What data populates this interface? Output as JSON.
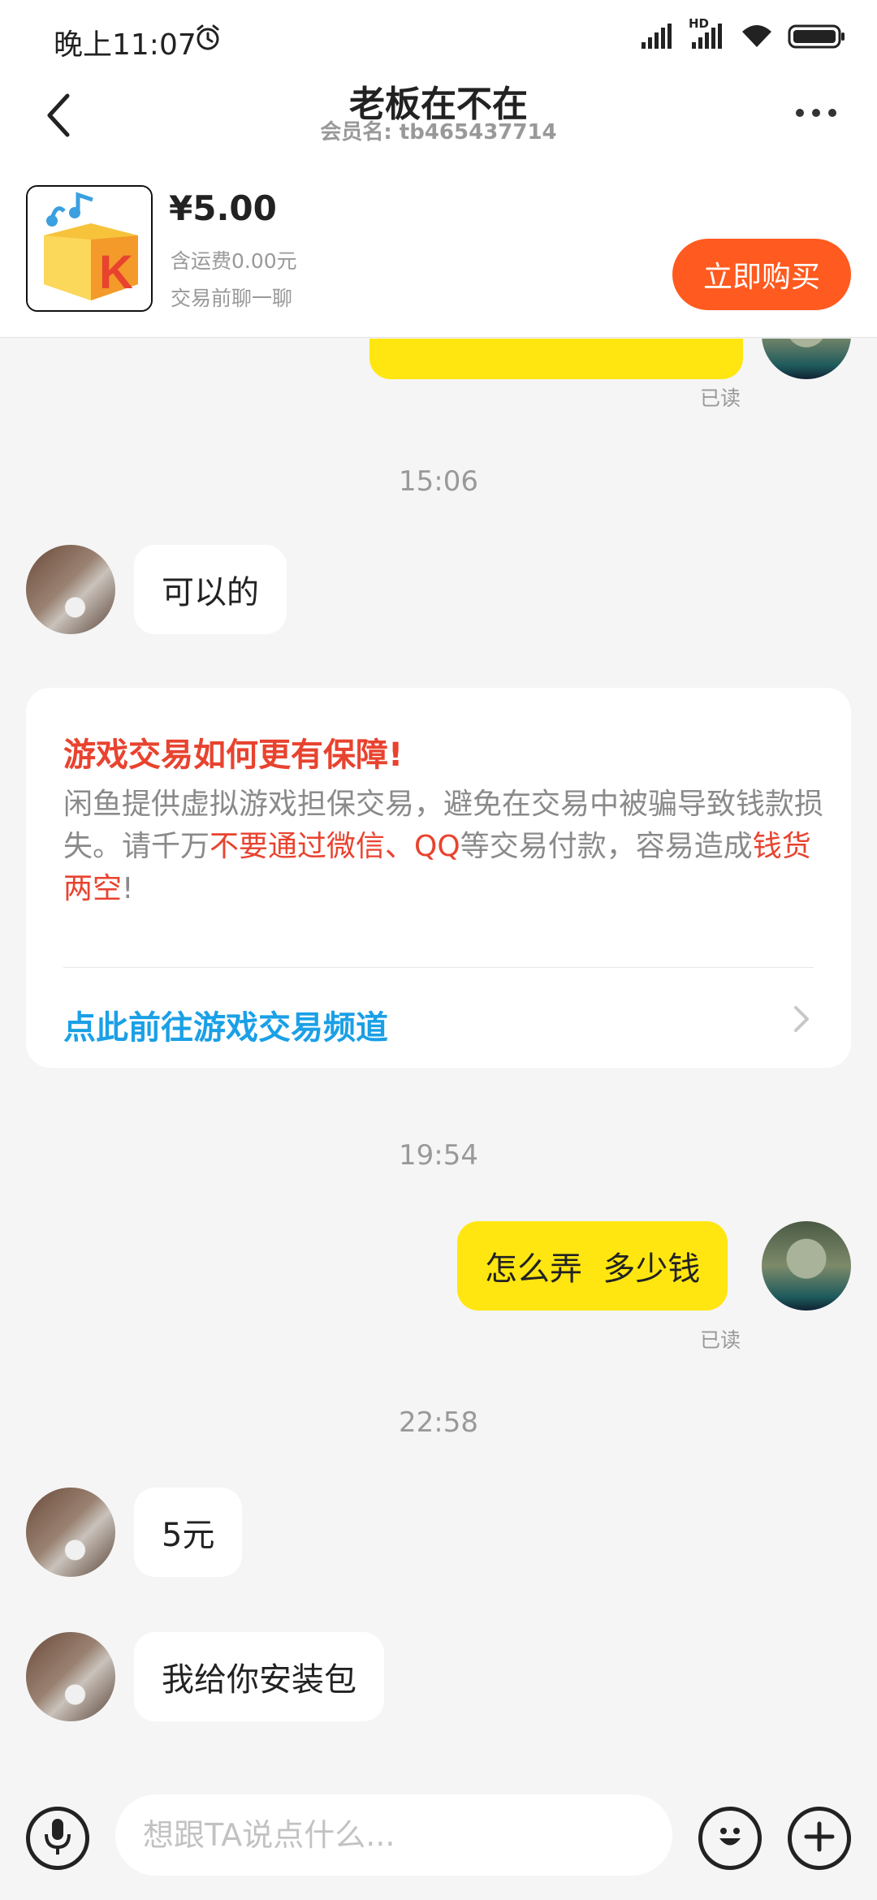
{
  "status_bar": {
    "time": "晚上11:07",
    "hd_label": "HD",
    "icons": [
      "alarm-icon",
      "signal-icon",
      "signal-hd-icon",
      "wifi-icon",
      "battery-icon"
    ]
  },
  "header": {
    "title": "老板在不在",
    "member_name": "会员名: tb465437714",
    "icons": [
      "back-arrow-icon",
      "more-dots-icon"
    ]
  },
  "product": {
    "price": "¥5.00",
    "shipping": "含运费0.00元",
    "note": "交易前聊一聊",
    "buy_label": "立即购买",
    "logo_letter": "K"
  },
  "messages": {
    "read_top": "已读",
    "time1": "15:06",
    "msg1": "可以的",
    "notice": {
      "title": "游戏交易如何更有保障!",
      "body_part1": "闲鱼提供虚拟游戏担保交易，避免在交易中被骗导致钱款损失。请千万",
      "body_red1": "不要通过微信、QQ",
      "body_part2": "等交易付款，容易造成",
      "body_red2": "钱货两空",
      "body_part3": "!",
      "link": "点此前往游戏交易频道"
    },
    "time2": "19:54",
    "msg2": "怎么弄  多少钱",
    "read2": "已读",
    "time3": "22:58",
    "msg3": "5元",
    "msg4": "我给你安装包"
  },
  "input_bar": {
    "placeholder": "想跟TA说点什么...",
    "icons": [
      "microphone-icon",
      "emoji-icon",
      "plus-icon"
    ]
  },
  "colors": {
    "accent_yellow": "#ffe611",
    "buy_orange": "#ff5a1f",
    "warning_red": "#e8432f",
    "link_blue": "#1aa0e6",
    "background": "#f5f5f5"
  }
}
